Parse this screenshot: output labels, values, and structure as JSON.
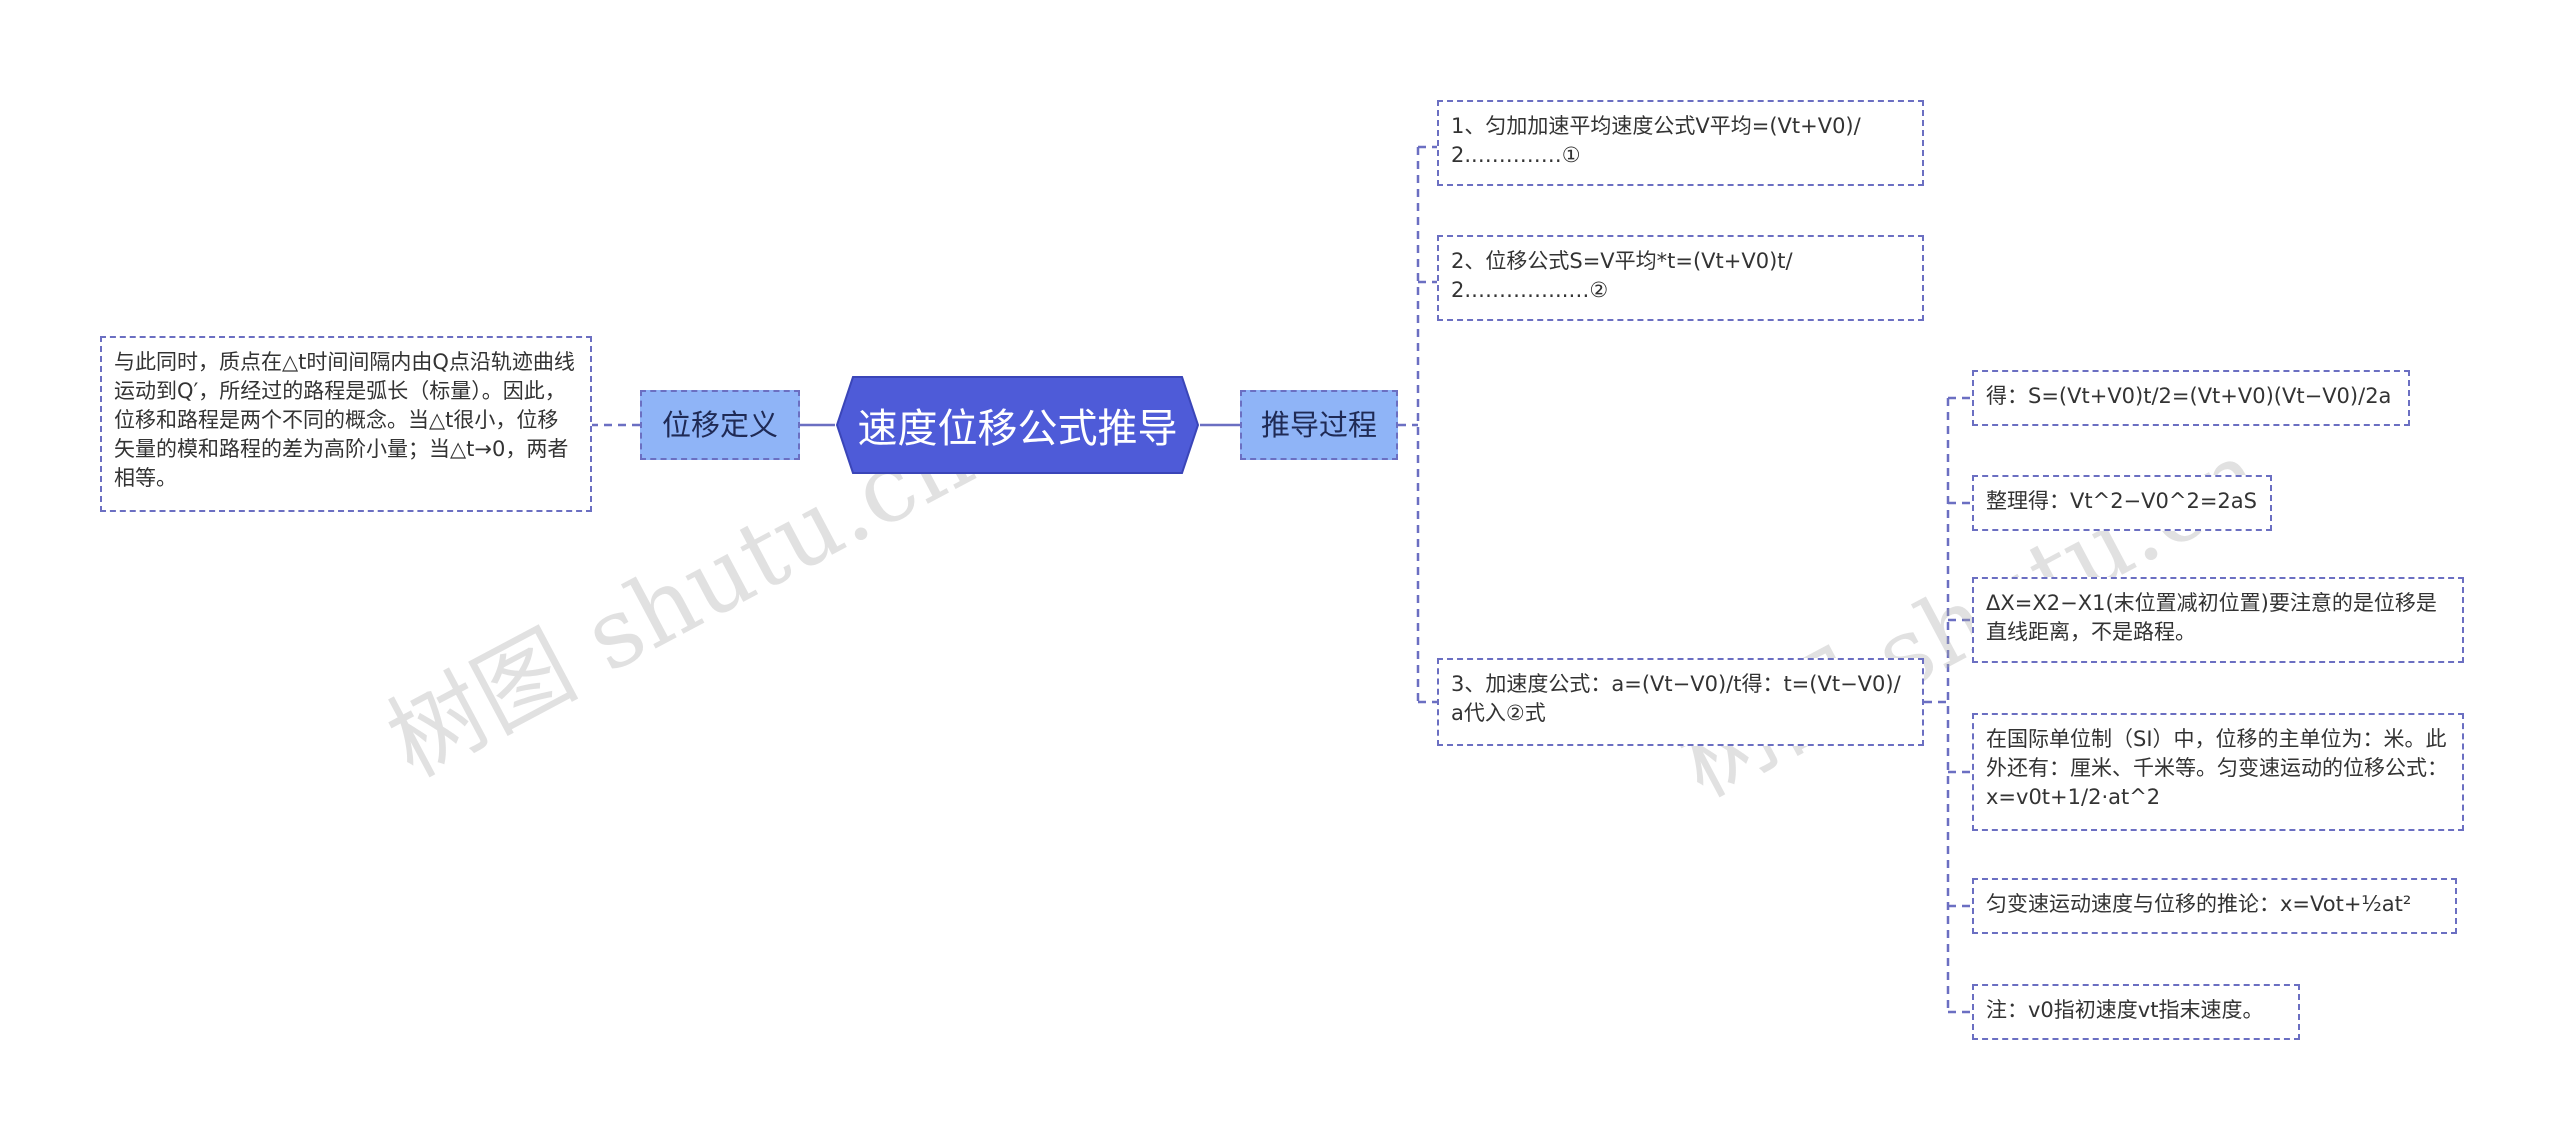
{
  "root": {
    "label": "速度位移公式推导",
    "fill": "#4e5bd8",
    "text_color": "#ffffff"
  },
  "branches": {
    "left": {
      "label": "位移定义",
      "fill": "#8fb4f7"
    },
    "right": {
      "label": "推导过程",
      "fill": "#8fb4f7"
    }
  },
  "left_leaves": [
    {
      "text": "与此同时，质点在△t时间间隔内由Q点沿轨迹曲线运动到Q′，所经过的路程是弧长（标量）。因此，位移和路程是两个不同的概念。当△t很小，位移矢量的模和路程的差为高阶小量；当△t→0，两者相等。"
    }
  ],
  "right_leaves": [
    {
      "text": "1、匀加加速平均速度公式V平均=(Vt+V0)/2..…………①"
    },
    {
      "text": "2、位移公式S=V平均*t=(Vt+V0)t/2.…………..…②"
    },
    {
      "text": "3、加速度公式：a=(Vt−V0)/t得：t=(Vt−V0)/a代入②式"
    }
  ],
  "sub_leaves": [
    {
      "text": "得：S=(Vt+V0)t/2=(Vt+V0)(Vt−V0)/2a"
    },
    {
      "text": "整理得：Vt^2−V0^2=2aS"
    },
    {
      "text": "ΔX=X2−X1(末位置减初位置)要注意的是位移是直线距离，不是路程。"
    },
    {
      "text": "在国际单位制（SI）中，位移的主单位为：米。此外还有：厘米、千米等。匀变速运动的位移公式：x=v0t+1/2·at^2"
    },
    {
      "text": "匀变速运动速度与位移的推论：x=Vot+½at²"
    },
    {
      "text": "注：v0指初速度vt指末速度。"
    }
  ],
  "watermarks": [
    "树图 shutu.cn",
    "树图 shutu.cn"
  ],
  "colors": {
    "connector": "#6b6fc2",
    "border": "#6b6fc2"
  }
}
